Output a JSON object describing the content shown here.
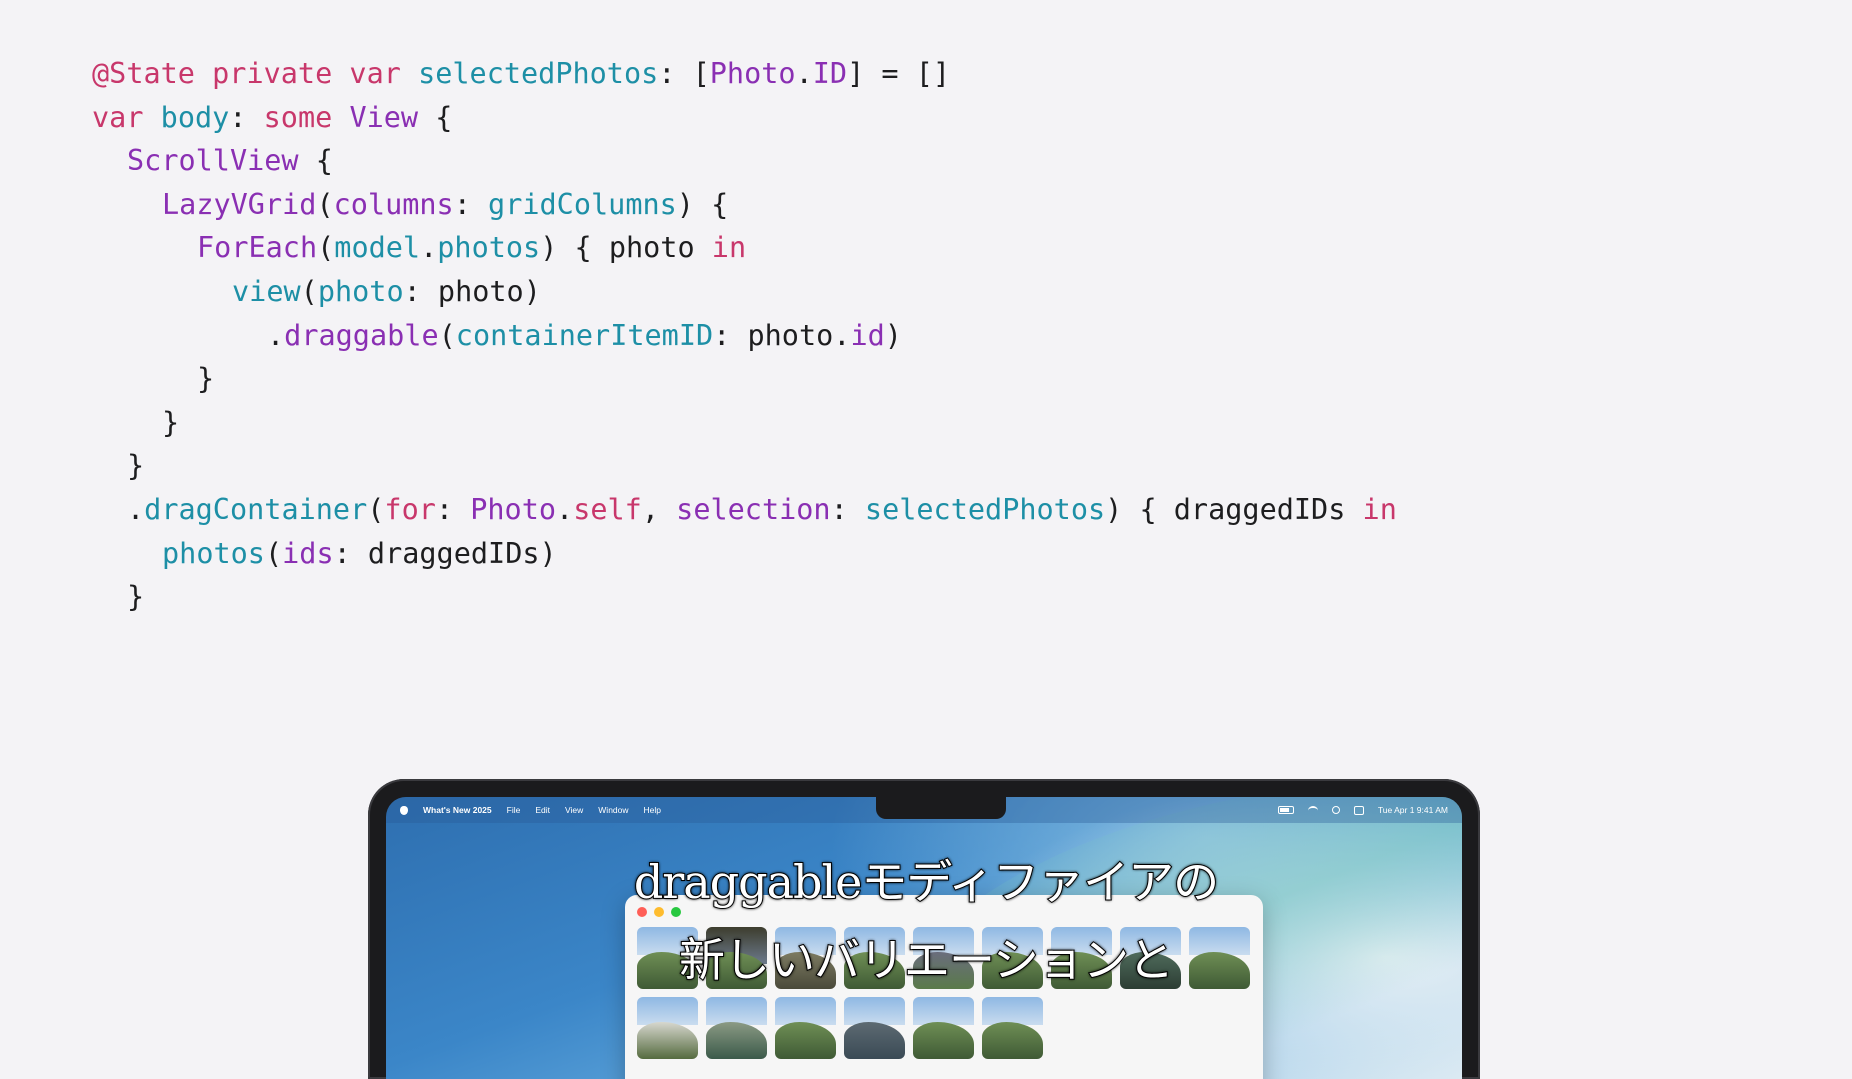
{
  "code": {
    "lines": [
      [
        [
          "kw",
          "@State"
        ],
        [
          "pl",
          " "
        ],
        [
          "kw",
          "private"
        ],
        [
          "pl",
          " "
        ],
        [
          "kw",
          "var"
        ],
        [
          "pl",
          " "
        ],
        [
          "id",
          "selectedPhotos"
        ],
        [
          "pl",
          ": ["
        ],
        [
          "ty",
          "Photo"
        ],
        [
          "pl",
          "."
        ],
        [
          "ty",
          "ID"
        ],
        [
          "pl",
          "] = []"
        ]
      ],
      [
        [
          "kw",
          "var"
        ],
        [
          "pl",
          " "
        ],
        [
          "id",
          "body"
        ],
        [
          "pl",
          ": "
        ],
        [
          "kw",
          "some"
        ],
        [
          "pl",
          " "
        ],
        [
          "ty",
          "View"
        ],
        [
          "pl",
          " {"
        ]
      ],
      [
        [
          "ty",
          "ScrollView"
        ],
        [
          "pl",
          " {"
        ]
      ],
      [
        [
          "ty",
          "LazyVGrid"
        ],
        [
          "pl",
          "("
        ],
        [
          "ty",
          "columns"
        ],
        [
          "pl",
          ": "
        ],
        [
          "id",
          "gridColumns"
        ],
        [
          "pl",
          ") {"
        ]
      ],
      [
        [
          "ty",
          "ForEach"
        ],
        [
          "pl",
          "("
        ],
        [
          "id",
          "model"
        ],
        [
          "pl",
          "."
        ],
        [
          "id",
          "photos"
        ],
        [
          "pl",
          ") { photo "
        ],
        [
          "kw",
          "in"
        ]
      ],
      [
        [
          "id",
          "view"
        ],
        [
          "pl",
          "("
        ],
        [
          "id",
          "photo"
        ],
        [
          "pl",
          ": photo)"
        ]
      ],
      [
        [
          "pl",
          "."
        ],
        [
          "fn",
          "draggable"
        ],
        [
          "pl",
          "("
        ],
        [
          "id",
          "containerItemID"
        ],
        [
          "pl",
          ": photo."
        ],
        [
          "fn",
          "id"
        ],
        [
          "pl",
          ")"
        ]
      ],
      [
        [
          "pl",
          "}"
        ]
      ],
      [
        [
          "pl",
          "}"
        ]
      ],
      [
        [
          "pl",
          "}"
        ]
      ],
      [
        [
          "pl",
          "."
        ],
        [
          "id",
          "dragContainer"
        ],
        [
          "pl",
          "("
        ],
        [
          "kw",
          "for"
        ],
        [
          "pl",
          ": "
        ],
        [
          "ty",
          "Photo"
        ],
        [
          "pl",
          "."
        ],
        [
          "kw",
          "self"
        ],
        [
          "pl",
          ", "
        ],
        [
          "fn",
          "selection"
        ],
        [
          "pl",
          ": "
        ],
        [
          "id",
          "selectedPhotos"
        ],
        [
          "pl",
          ") { draggedIDs "
        ],
        [
          "kw",
          "in"
        ]
      ],
      [
        [
          "id",
          "photos"
        ],
        [
          "pl",
          "("
        ],
        [
          "fn",
          "ids"
        ],
        [
          "pl",
          ": draggedIDs)"
        ]
      ],
      [
        [
          "pl",
          "}"
        ]
      ]
    ],
    "indents": [
      0,
      0,
      1,
      2,
      3,
      4,
      5,
      3,
      2,
      1,
      1,
      2,
      1
    ]
  },
  "menubar": {
    "app_name": "What's New 2025",
    "items": [
      "File",
      "Edit",
      "View",
      "Window",
      "Help"
    ],
    "clock": "Tue Apr 1  9:41 AM",
    "icons": [
      "apple-icon",
      "battery-icon",
      "wifi-icon",
      "search-icon",
      "control-center-icon"
    ]
  },
  "photos": {
    "count": 15
  },
  "subtitles": {
    "line1": "draggableモディファイアの",
    "line2": "新しいバリエーションと"
  },
  "colors": {
    "keyword": "#c8376b",
    "type": "#8a2fb3",
    "identifier": "#1d8fa6",
    "background": "#f4f3f6"
  }
}
